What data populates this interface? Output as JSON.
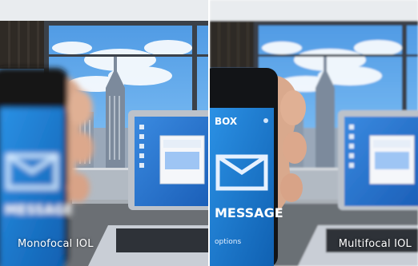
{
  "panels": {
    "left": {
      "caption": "Monofocal IOL"
    },
    "right": {
      "caption": "Multifocal IOL"
    }
  },
  "phone": {
    "right_top_label": "BOX",
    "right_message_label": "MESSAGE",
    "right_footer_label": "options",
    "left_message_label": "MESSAGE"
  },
  "colors": {
    "sky": "#5aa4ea",
    "city": "#a7b6c8",
    "window_frame": "#3b4149",
    "curtain": "#2f2a25",
    "phone_screen": "#1f7fd3",
    "laptop_desktop": "#2d79d5",
    "laptop_frame": "#bcc2ca"
  }
}
